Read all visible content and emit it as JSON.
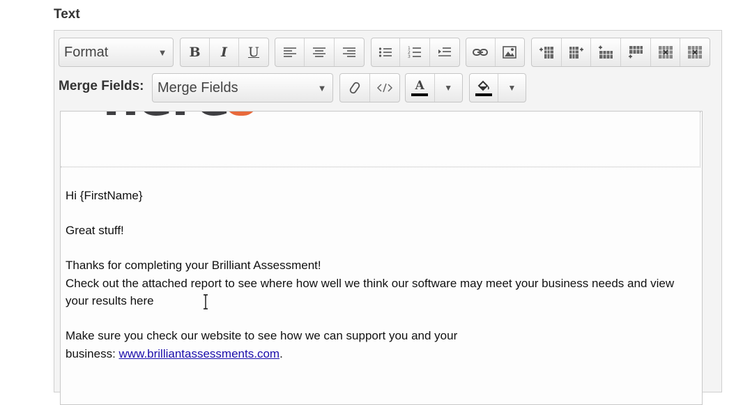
{
  "section_label": "Text",
  "toolbar": {
    "format_dropdown": "Format",
    "bold": "B",
    "italic": "I",
    "underline": "U",
    "merge_label": "Merge Fields:",
    "merge_dropdown": "Merge Fields",
    "text_color_glyph": "A"
  },
  "colors": {
    "link": "#1a0dab",
    "logo_dark": "#3f3f42",
    "logo_accent": "#e8693b",
    "text_color_swatch": "#000000",
    "bg_color_swatch": "#000000"
  },
  "content": {
    "logo_text": "nere",
    "greeting": "Hi {FirstName}",
    "line1": "Great stuff!",
    "line2": "Thanks for completing your Brilliant Assessment!",
    "line3": "Check out the attached report to see where how well we think our software may meet your business needs and view your results here",
    "line4": "Make sure you check our website to see how we can support you and your",
    "line5_prefix": "business: ",
    "link_text": "www.brilliantassessments.com",
    "line5_suffix": "."
  }
}
